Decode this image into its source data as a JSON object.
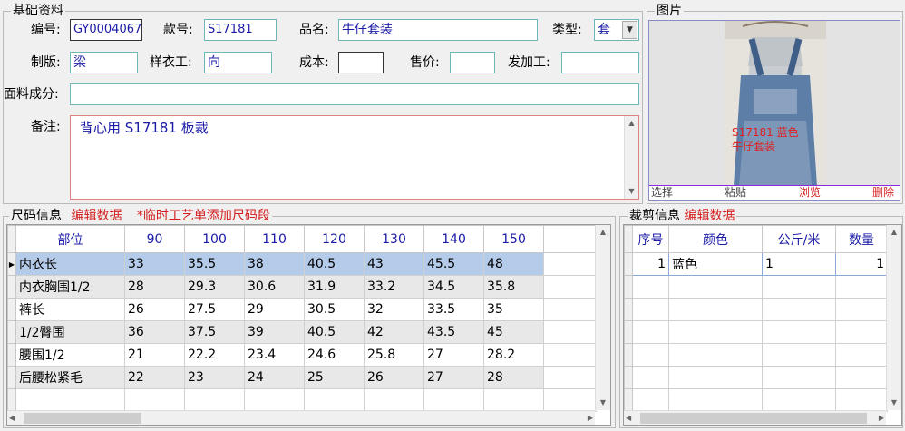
{
  "basic": {
    "title": "基础资料",
    "code_label": "编号:",
    "code_value": "GY0004067",
    "style_label": "款号:",
    "style_value": "S17181",
    "name_label": "品名:",
    "name_value": "牛仔套装",
    "type_label": "类型:",
    "type_value": "套",
    "pattern_label": "制版:",
    "pattern_value": "梁",
    "sample_label": "样衣工:",
    "sample_value": "向",
    "cost_label": "成本:",
    "cost_value": "",
    "price_label": "售价:",
    "price_value": "",
    "process_label": "发加工:",
    "process_value": "",
    "fabric_label": "面料成分:",
    "fabric_value": "",
    "remark_label": "备注:",
    "remark_value": "背心用 S17181 板裁"
  },
  "picture": {
    "title": "图片",
    "overlay_line1": "S17181 蓝色",
    "overlay_line2": "牛仔套装",
    "actions": [
      "选择",
      "粘贴",
      "浏览",
      "删除"
    ]
  },
  "size": {
    "title": "尺码信息",
    "edit_link": "编辑数据",
    "note": "*临时工艺单添加尺码段",
    "columns": [
      "部位",
      "90",
      "100",
      "110",
      "120",
      "130",
      "140",
      "150"
    ],
    "rows": [
      [
        "内衣长",
        "33",
        "35.5",
        "38",
        "40.5",
        "43",
        "45.5",
        "48"
      ],
      [
        "内衣胸围1/2",
        "28",
        "29.3",
        "30.6",
        "31.9",
        "33.2",
        "34.5",
        "35.8"
      ],
      [
        "裤长",
        "26",
        "27.5",
        "29",
        "30.5",
        "32",
        "33.5",
        "35"
      ],
      [
        "1/2臀围",
        "36",
        "37.5",
        "39",
        "40.5",
        "42",
        "43.5",
        "45"
      ],
      [
        "腰围1/2",
        "21",
        "22.2",
        "23.4",
        "24.6",
        "25.8",
        "27",
        "28.2"
      ],
      [
        "后腰松紧毛",
        "22",
        "23",
        "24",
        "25",
        "26",
        "27",
        "28"
      ]
    ]
  },
  "cut": {
    "title": "裁剪信息",
    "edit_link": "编辑数据",
    "columns": [
      "序号",
      "颜色",
      "公斤/米",
      "数量"
    ],
    "rows": [
      [
        "1",
        "蓝色",
        "1",
        "1"
      ]
    ]
  }
}
